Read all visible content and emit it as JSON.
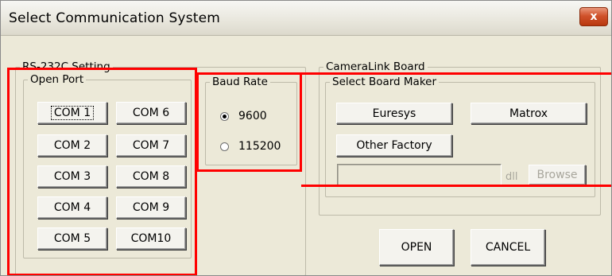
{
  "window": {
    "title": "Select Communication System",
    "close_label": "x"
  },
  "rs232c": {
    "legend": "RS-232C Setting",
    "open_port": {
      "legend": "Open Port",
      "ports": [
        "COM 1",
        "COM 6",
        "COM 2",
        "COM 7",
        "COM 3",
        "COM 8",
        "COM 4",
        "COM 9",
        "COM 5",
        "COM10"
      ]
    },
    "baud": {
      "legend": "Baud Rate",
      "options": [
        "9600",
        "115200"
      ],
      "selected": "9600"
    }
  },
  "cameralink": {
    "legend": "CameraLink Board",
    "maker": {
      "legend": "Select Board Maker",
      "buttons": [
        "Euresys",
        "Matrox",
        "Other Factory"
      ],
      "dll_path": "",
      "dll_label": "dll",
      "browse_label": "Browse"
    }
  },
  "actions": {
    "open_label": "OPEN",
    "cancel_label": "CANCEL"
  },
  "colors": {
    "highlight": "#ff0000",
    "dialog_bg": "#ece9d8",
    "close_red": "#c0451a"
  }
}
